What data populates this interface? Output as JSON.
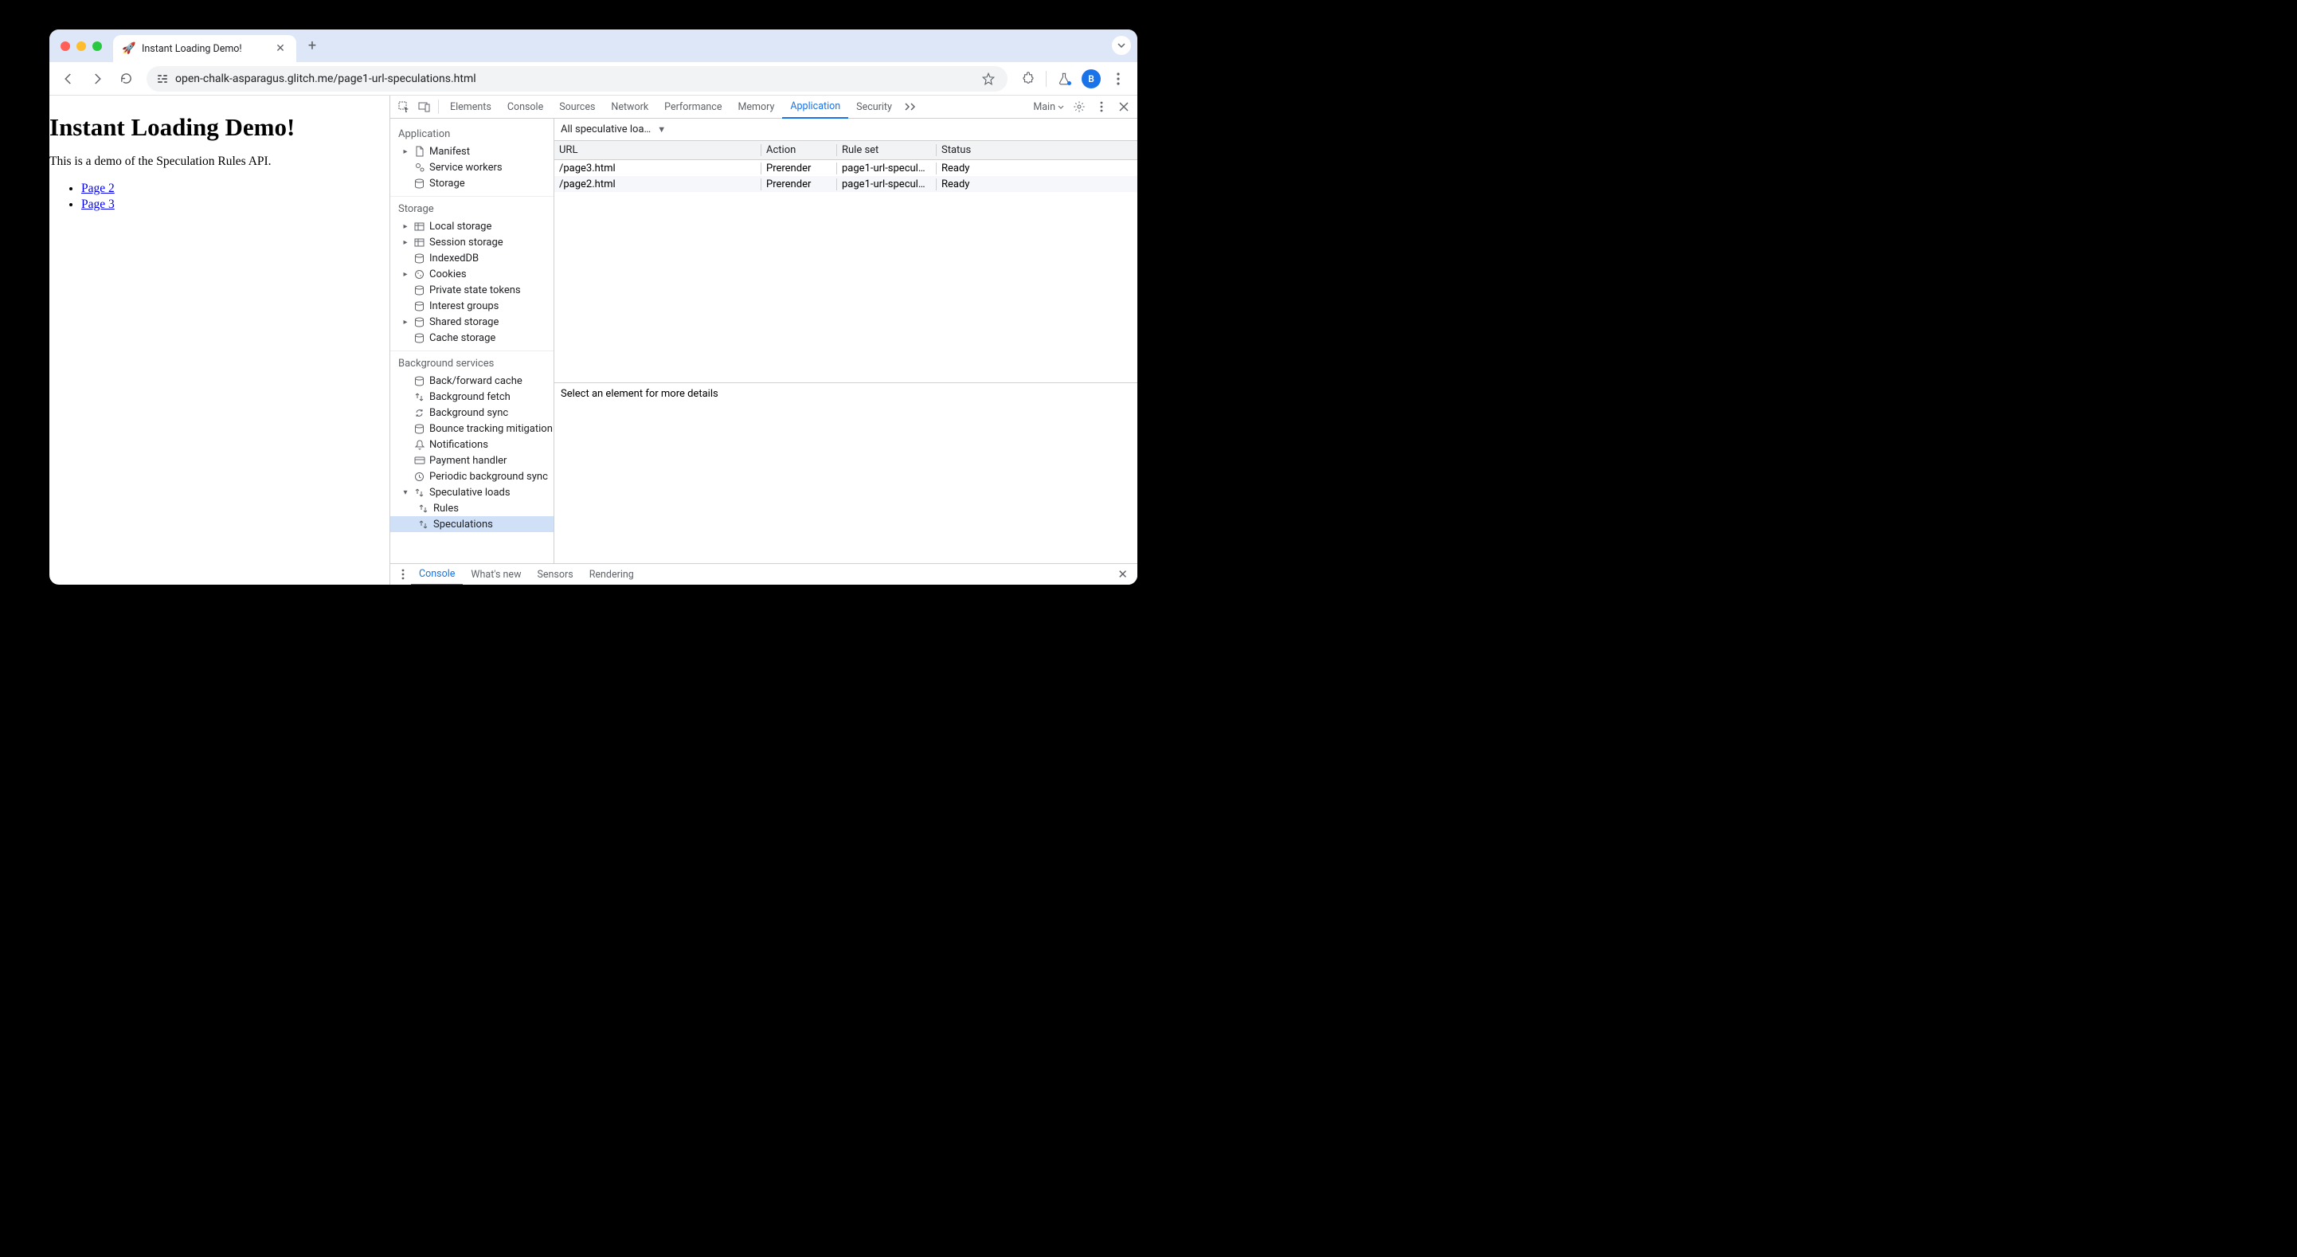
{
  "browser": {
    "tab_title": "Instant Loading Demo!",
    "url": "open-chalk-asparagus.glitch.me/page1-url-speculations.html",
    "avatar_letter": "B"
  },
  "page": {
    "h1": "Instant Loading Demo!",
    "p": "This is a demo of the Speculation Rules API.",
    "links": [
      "Page 2",
      "Page 3"
    ]
  },
  "devtools": {
    "tabs": [
      "Elements",
      "Console",
      "Sources",
      "Network",
      "Performance",
      "Memory",
      "Application",
      "Security"
    ],
    "active_tab": "Application",
    "main_label": "Main",
    "sidebar": {
      "application": {
        "heading": "Application",
        "items": [
          "Manifest",
          "Service workers",
          "Storage"
        ]
      },
      "storage": {
        "heading": "Storage",
        "items": [
          "Local storage",
          "Session storage",
          "IndexedDB",
          "Cookies",
          "Private state tokens",
          "Interest groups",
          "Shared storage",
          "Cache storage"
        ]
      },
      "background": {
        "heading": "Background services",
        "items": [
          "Back/forward cache",
          "Background fetch",
          "Background sync",
          "Bounce tracking mitigation",
          "Notifications",
          "Payment handler",
          "Periodic background sync",
          "Speculative loads"
        ],
        "children": [
          "Rules",
          "Speculations"
        ],
        "selected": "Speculations"
      }
    },
    "panel": {
      "filter": "All speculative loa…",
      "columns": [
        "URL",
        "Action",
        "Rule set",
        "Status"
      ],
      "rows": [
        {
          "url": "/page3.html",
          "action": "Prerender",
          "rule": "page1-url-specul…",
          "status": "Ready"
        },
        {
          "url": "/page2.html",
          "action": "Prerender",
          "rule": "page1-url-specul…",
          "status": "Ready"
        }
      ],
      "detail": "Select an element for more details"
    },
    "drawer": {
      "tabs": [
        "Console",
        "What's new",
        "Sensors",
        "Rendering"
      ],
      "active": "Console"
    }
  }
}
